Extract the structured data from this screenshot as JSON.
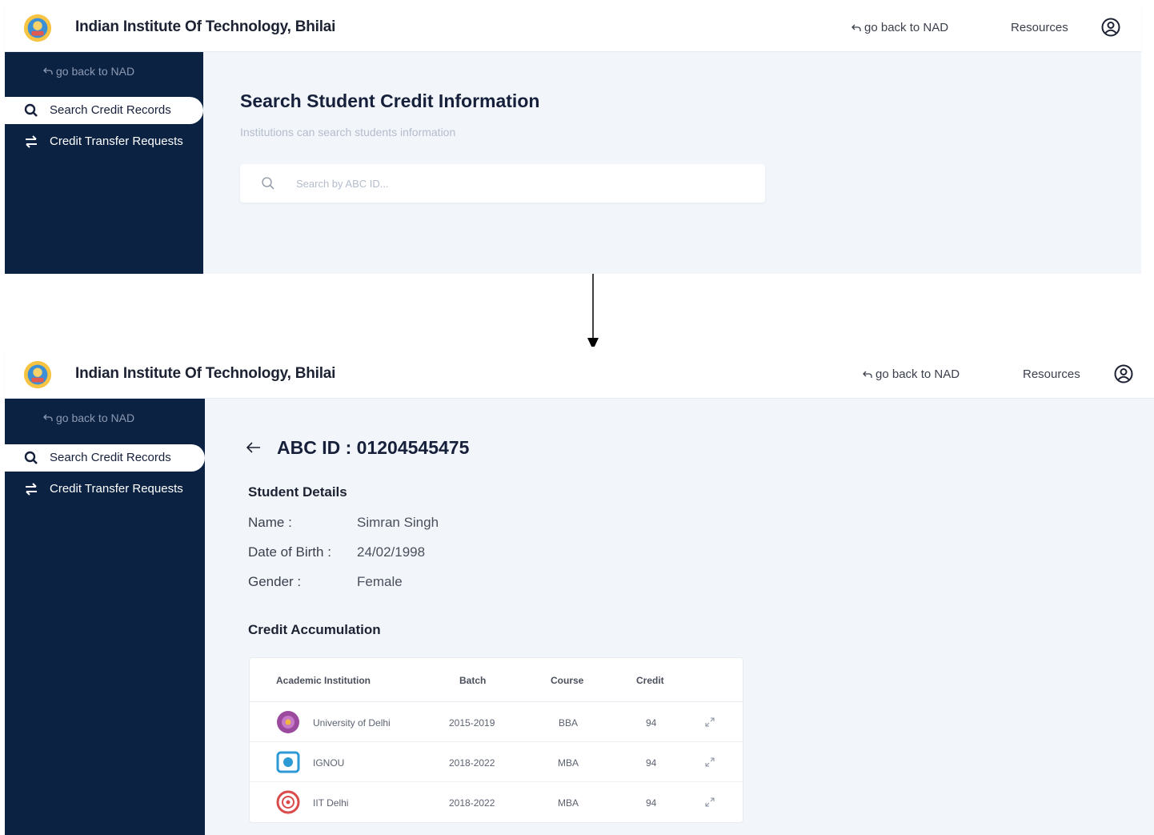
{
  "header": {
    "institution": "Indian Institute Of Technology, Bhilai",
    "back_label": "go back to NAD",
    "resources_label": "Resources"
  },
  "sidebar": {
    "back_label": "go back to NAD",
    "items": [
      {
        "label": "Search Credit Records",
        "icon": "search-icon",
        "active": true
      },
      {
        "label": "Credit Transfer Requests",
        "icon": "transfer-icon",
        "active": false
      }
    ]
  },
  "search_page": {
    "title": "Search Student Credit Information",
    "subtitle": "Institutions can search students information",
    "search_placeholder": "Search by ABC ID..."
  },
  "student_page": {
    "title": "ABC ID : 01204545475",
    "details_heading": "Student Details",
    "details": [
      {
        "label": "Name :",
        "value": "Simran Singh"
      },
      {
        "label": "Date of Birth :",
        "value": "24/02/1998"
      },
      {
        "label": "Gender :",
        "value": "Female"
      }
    ],
    "credits_heading": "Credit Accumulation",
    "columns": [
      "Academic Institution",
      "Batch",
      "Course",
      "Credit"
    ],
    "rows": [
      {
        "institution": "University of Delhi",
        "batch": "2015-2019",
        "course": "BBA",
        "credit": "94",
        "logo_color": "#9b4a9e"
      },
      {
        "institution": "IGNOU",
        "batch": "2018-2022",
        "course": "MBA",
        "credit": "94",
        "logo_color": "#2d9ad6"
      },
      {
        "institution": "IIT Delhi",
        "batch": "2018-2022",
        "course": "MBA",
        "credit": "94",
        "logo_color": "#d94b4b"
      }
    ]
  },
  "colors": {
    "sidebar_bg": "#0b2243",
    "main_bg": "#f2f6fb",
    "accent_text": "#16203a"
  }
}
